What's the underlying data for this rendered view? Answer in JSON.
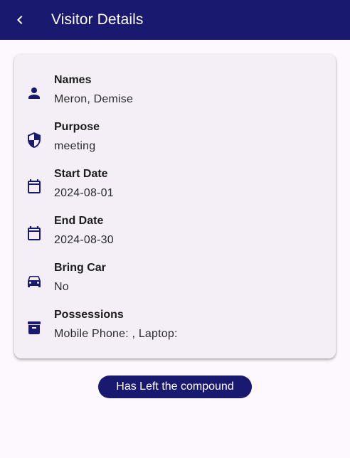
{
  "app_bar": {
    "title": "Visitor Details",
    "back_icon": "chevron-left-icon",
    "color": "#1a1970"
  },
  "details": [
    {
      "icon": "person-icon",
      "label": "Names",
      "value": "Meron, Demise"
    },
    {
      "icon": "shield-icon",
      "label": "Purpose",
      "value": "meeting"
    },
    {
      "icon": "calendar-icon",
      "label": "Start Date",
      "value": "2024-08-01"
    },
    {
      "icon": "calendar-icon",
      "label": "End Date",
      "value": "2024-08-30"
    },
    {
      "icon": "car-icon",
      "label": "Bring Car",
      "value": "No"
    },
    {
      "icon": "archive-icon",
      "label": "Possessions",
      "value": "Mobile Phone: , Laptop:"
    }
  ],
  "action": {
    "label": "Has Left the compound"
  }
}
